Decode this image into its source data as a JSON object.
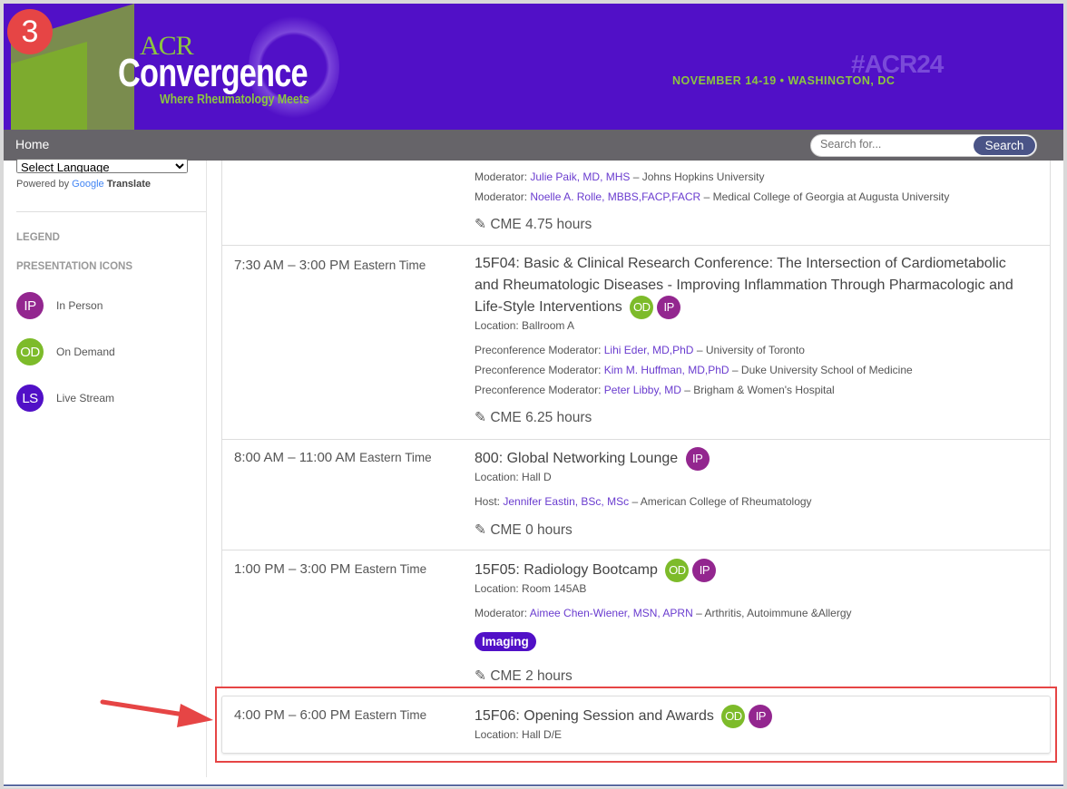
{
  "step_badge": "3",
  "header": {
    "logo_top": "ACR",
    "logo_main": "Convergence",
    "logo_tagline": "Where Rheumatology Meets",
    "dates": "NOVEMBER 14-19 • WASHINGTON, DC",
    "hashtag": "#ACR24",
    "colors": {
      "purple": "#5110c7",
      "green": "#7dbb2a"
    }
  },
  "nav": {
    "home": "Home",
    "search_placeholder": "Search for...",
    "search_button": "Search"
  },
  "sidebar": {
    "language_select": "Select Language",
    "powered_by": "Powered by",
    "google": "Google",
    "translate": "Translate",
    "legend": "LEGEND",
    "presentation_icons": "PRESENTATION ICONS",
    "icons": [
      {
        "abbr": "IP",
        "label": "In Person"
      },
      {
        "abbr": "OD",
        "label": "On Demand"
      },
      {
        "abbr": "LS",
        "label": "Live Stream"
      }
    ]
  },
  "sessions": [
    {
      "people": [
        {
          "role": "Moderator:",
          "name": "Julie Paik, MD, MHS",
          "affil": "– Johns Hopkins University"
        },
        {
          "role": "Moderator:",
          "name": "Noelle A. Rolle, MBBS,FACP,FACR",
          "affil": "– Medical College of Georgia at Augusta University"
        }
      ],
      "cme": "CME 4.75 hours"
    },
    {
      "time": "7:30 AM – 3:00 PM",
      "tz": "Eastern Time",
      "title_l1": "15F04: Basic & Clinical Research Conference: The Intersection of Cardiometabolic",
      "title_l2": "and Rheumatologic Diseases - Improving Inflammation Through Pharmacologic and",
      "title_l3": "Life-Style Interventions",
      "badges": [
        "OD",
        "IP"
      ],
      "location": "Location: Ballroom A",
      "people": [
        {
          "role": "Preconference Moderator:",
          "name": "Lihi Eder, MD,PhD",
          "affil": "– University of Toronto"
        },
        {
          "role": "Preconference Moderator:",
          "name": "Kim M. Huffman, MD,PhD",
          "affil": "– Duke University School of Medicine"
        },
        {
          "role": "Preconference Moderator:",
          "name": "Peter Libby, MD",
          "affil": "– Brigham & Women's Hospital"
        }
      ],
      "cme": "CME 6.25 hours"
    },
    {
      "time": "8:00 AM – 11:00 AM",
      "tz": "Eastern Time",
      "title": "800: Global Networking Lounge",
      "badges": [
        "IP"
      ],
      "location": "Location: Hall D",
      "people": [
        {
          "role": "Host:",
          "name": "Jennifer Eastin, BSc, MSc",
          "affil": "– American College of Rheumatology"
        }
      ],
      "cme": "CME 0 hours"
    },
    {
      "time": "1:00 PM – 3:00 PM",
      "tz": "Eastern Time",
      "title": "15F05: Radiology Bootcamp",
      "badges": [
        "OD",
        "IP"
      ],
      "location": "Location: Room 145AB",
      "people": [
        {
          "role": "Moderator:",
          "name": "Aimee Chen-Wiener, MSN, APRN",
          "affil": "– Arthritis, Autoimmune &Allergy"
        }
      ],
      "tag": "Imaging",
      "cme": "CME 2 hours"
    },
    {
      "time": "4:00 PM – 6:00 PM",
      "tz": "Eastern Time",
      "title": "15F06: Opening Session and Awards",
      "badges": [
        "OD",
        "IP"
      ],
      "location": "Location: Hall D/E"
    }
  ]
}
